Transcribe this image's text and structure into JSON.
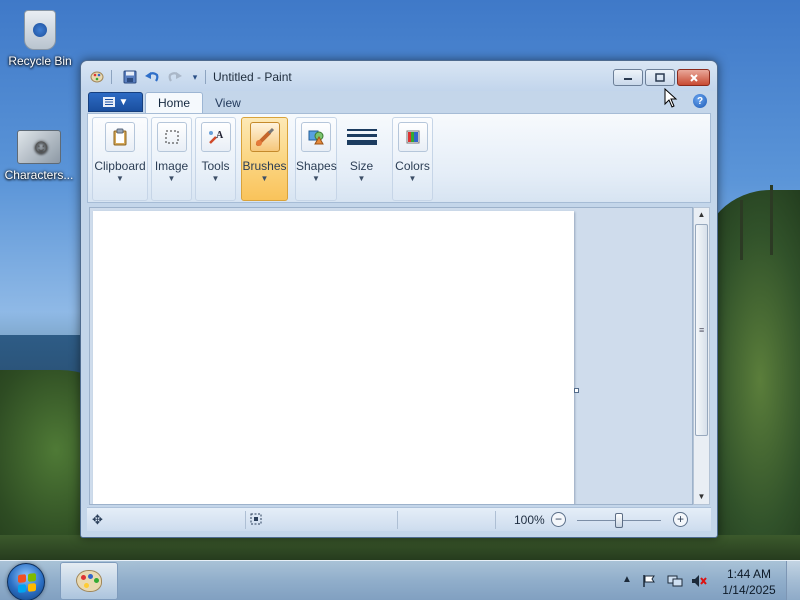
{
  "desktop": {
    "icons": [
      {
        "label": "Recycle Bin",
        "icon": "recycle-bin-icon"
      },
      {
        "label": "Characters...",
        "icon": "characters-icon"
      }
    ]
  },
  "window": {
    "title": "Untitled - Paint",
    "quick_access": [
      "paint-app-icon",
      "save-icon",
      "undo-icon",
      "redo-icon",
      "customize-dropdown-icon"
    ],
    "tabs": [
      {
        "label": "Home",
        "active": true
      },
      {
        "label": "View",
        "active": false
      }
    ],
    "ribbon_groups": [
      {
        "label": "Clipboard",
        "icon": "clipboard-icon"
      },
      {
        "label": "Image",
        "icon": "select-icon"
      },
      {
        "label": "Tools",
        "icon": "tools-icon"
      },
      {
        "label": "Brushes",
        "icon": "brush-icon",
        "selected": true
      },
      {
        "label": "Shapes",
        "icon": "shapes-icon"
      },
      {
        "label": "Size",
        "icon": "size-icon"
      },
      {
        "label": "Colors",
        "icon": "colors-icon"
      }
    ],
    "status": {
      "zoom_label": "100%",
      "zoom_value": 100
    }
  },
  "taskbar": {
    "time": "1:44 AM",
    "date": "1/14/2025",
    "pinned": [
      "paint-taskbar-icon"
    ],
    "tray": [
      "show-hidden-icons",
      "action-center-flag-icon",
      "network-icon",
      "volume-muted-icon"
    ]
  },
  "colors": {
    "accent_selected": "#f9c35b",
    "close_button": "#c84a32",
    "ribbon_bg": "#e4edf7"
  }
}
